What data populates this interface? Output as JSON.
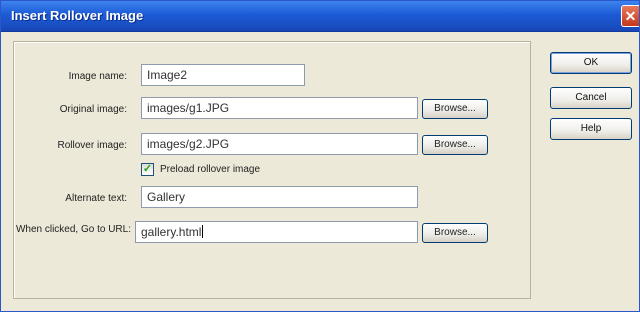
{
  "window": {
    "title": "Insert Rollover Image",
    "close_glyph": "✕"
  },
  "form": {
    "image_name": {
      "label": "Image name:",
      "value": "Image2"
    },
    "original_image": {
      "label": "Original image:",
      "value": "images/g1.JPG",
      "browse_label": "Browse..."
    },
    "rollover_image": {
      "label": "Rollover image:",
      "value": "images/g2.JPG",
      "browse_label": "Browse..."
    },
    "preload": {
      "label": "Preload rollover image",
      "checked": true,
      "check_glyph": "✓"
    },
    "alternate_text": {
      "label": "Alternate text:",
      "value": "Gallery"
    },
    "when_clicked": {
      "label": "When clicked, Go to URL:",
      "value": "gallery.html",
      "browse_label": "Browse..."
    }
  },
  "buttons": {
    "ok": "OK",
    "cancel": "Cancel",
    "help": "Help"
  }
}
